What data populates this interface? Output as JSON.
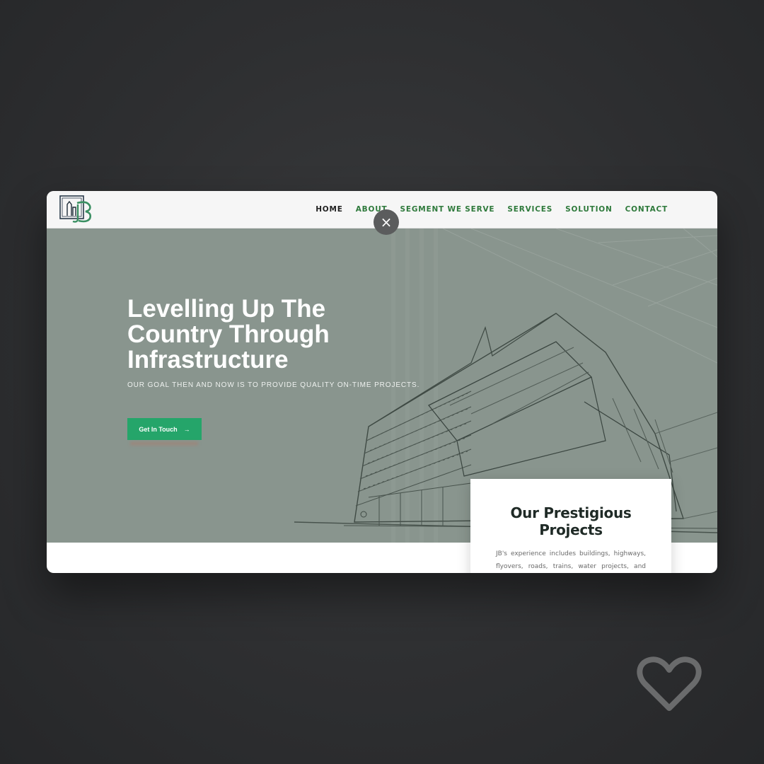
{
  "modal": {
    "close_glyph": "×",
    "nav": {
      "items": [
        {
          "label": "HOME",
          "active": true
        },
        {
          "label": "ABOUT",
          "active": false
        },
        {
          "label": "SEGMENT WE SERVE",
          "active": false
        },
        {
          "label": "SERVICES",
          "active": false
        },
        {
          "label": "SOLUTION",
          "active": false
        },
        {
          "label": "CONTACT",
          "active": false
        }
      ]
    },
    "hero": {
      "title_lines": [
        "Levelling Up The",
        "Country Through",
        "Infrastructure"
      ],
      "subtitle": "OUR GOAL THEN AND NOW IS TO PROVIDE QUALITY ON-TIME PROJECTS.",
      "cta_label": "Get In Touch",
      "cta_arrow": "→"
    },
    "projects_card": {
      "title_lines": [
        "Our Prestigious",
        "Projects"
      ],
      "text": "JB's experience includes buildings, highways, flyovers, roads, trains, water projects, and"
    }
  },
  "colors": {
    "accent_green": "#25a56a",
    "nav_green": "#2f7a3c",
    "hero_bg": "#89958e"
  },
  "icons": [
    "jb-logo-icon",
    "close-icon",
    "arrow-right-icon",
    "heart-icon"
  ]
}
